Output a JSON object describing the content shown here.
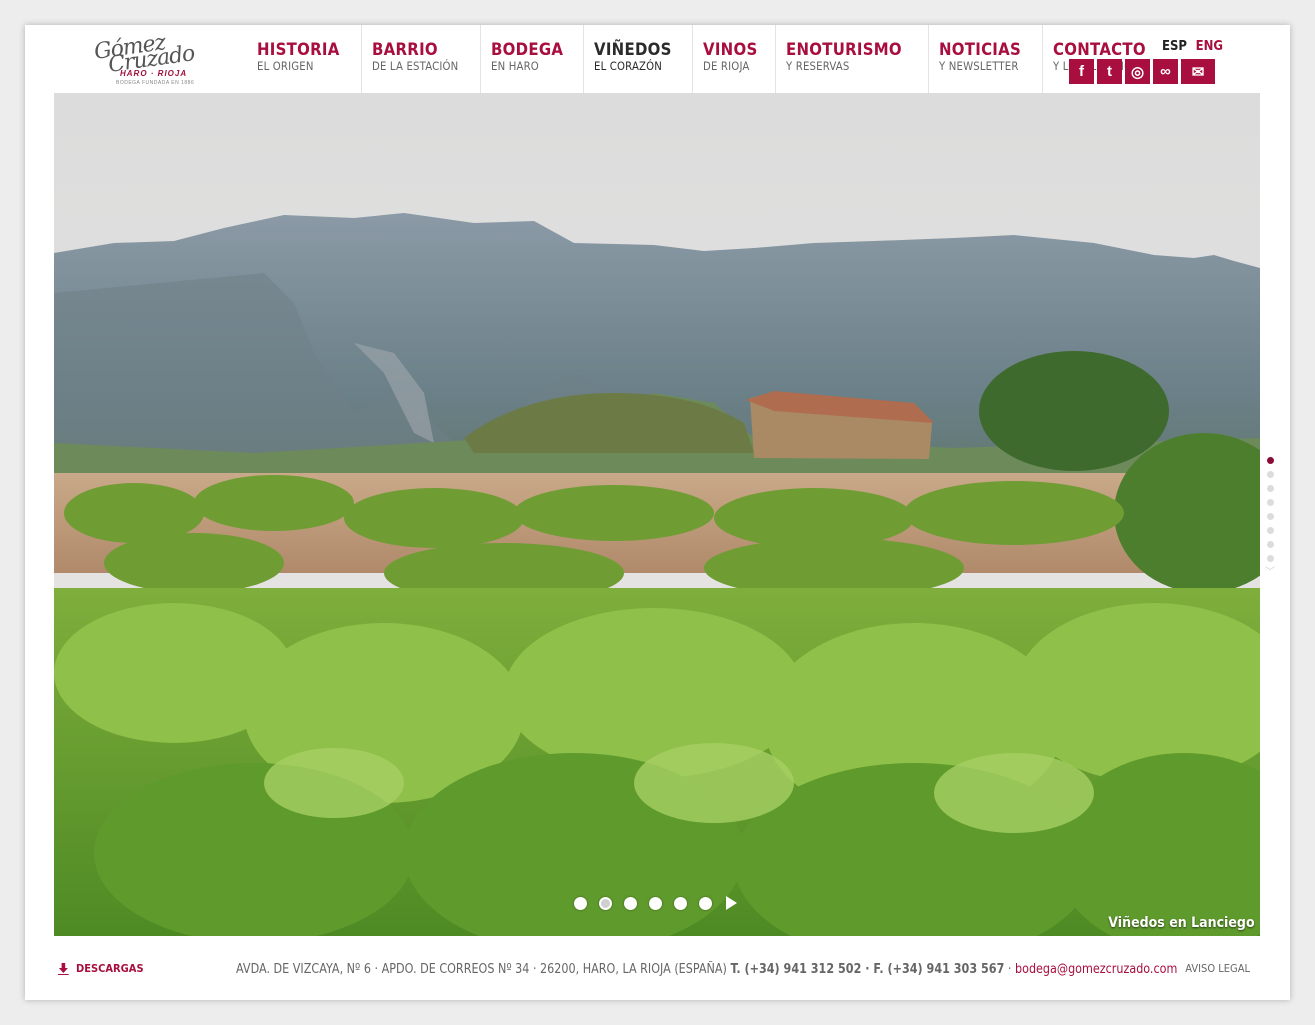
{
  "logo": {
    "line1": "Gómez",
    "line2": "Cruzado",
    "sub": "HARO · RIOJA",
    "small": "BODEGA FUNDADA EN 1886"
  },
  "nav": [
    {
      "title": "HISTORIA",
      "sub": "EL ORIGEN"
    },
    {
      "title": "BARRIO",
      "sub": "DE LA ESTACIÓN"
    },
    {
      "title": "BODEGA",
      "sub": "EN HARO"
    },
    {
      "title": "VIÑEDOS",
      "sub": "EL CORAZÓN",
      "active": true
    },
    {
      "title": "VINOS",
      "sub": "DE RIOJA"
    },
    {
      "title": "ENOTURISMO",
      "sub": "Y RESERVAS"
    },
    {
      "title": "NOTICIAS",
      "sub": "Y NEWSLETTER"
    },
    {
      "title": "CONTACTO",
      "sub": "Y LOCALIZACIÓN"
    }
  ],
  "lang": {
    "esp": "ESP",
    "eng": "ENG",
    "active": "ESP"
  },
  "socials": [
    {
      "icon": "facebook-icon",
      "glyph": "f"
    },
    {
      "icon": "twitter-icon",
      "glyph": "t"
    },
    {
      "icon": "instagram-icon",
      "glyph": "◎"
    },
    {
      "icon": "tripadvisor-icon",
      "glyph": "∞"
    },
    {
      "icon": "mail-icon",
      "glyph": "✉"
    }
  ],
  "hero": {
    "caption": "Viñedos en Lanciego",
    "slides_count": 6,
    "active_slide": 2
  },
  "side_nav": {
    "count": 8,
    "active": 1
  },
  "footer": {
    "descargas": "DESCARGAS",
    "address": "AVDA. DE VIZCAYA, Nº 6 · APDO. DE CORREOS Nº 34 · 26200, HARO, LA RIOJA (ESPAÑA)",
    "phone": "T. (+34) 941 312 502 · F. (+34) 941 303 567",
    "sep": " · ",
    "email": "bodega@gomezcruzado.com",
    "legal": "AVISO LEGAL"
  },
  "colors": {
    "accent": "#a80e3e",
    "text": "#666666",
    "active_nav": "#2b2b2b"
  }
}
